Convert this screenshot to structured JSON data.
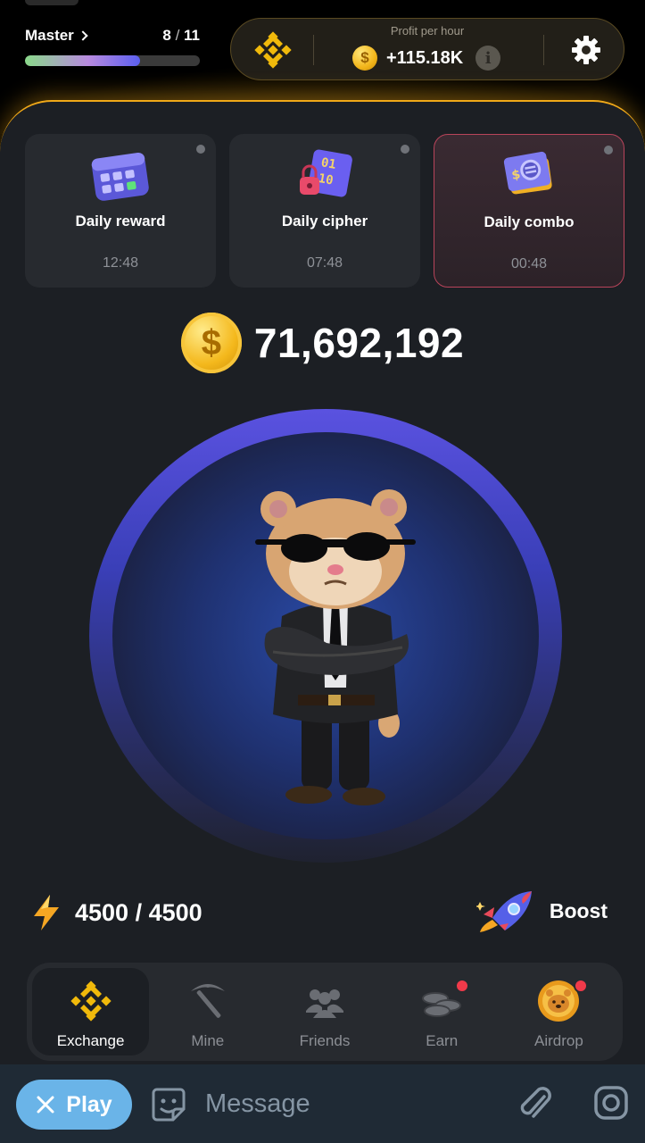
{
  "header": {
    "level_name": "Master",
    "level_current": "8",
    "level_separator": " / ",
    "level_total": "11",
    "level_progress": 0.66,
    "profit_label": "Profit per hour",
    "profit_value": "+115.18K",
    "profit_coin_symbol": "$",
    "info_symbol": "i",
    "exchange_icon": "binance-icon",
    "settings_icon": "gear-icon"
  },
  "daily_cards": [
    {
      "title": "Daily reward",
      "time": "12:48",
      "icon": "calendar-icon"
    },
    {
      "title": "Daily cipher",
      "time": "07:48",
      "icon": "cipher-lock-icon"
    },
    {
      "title": "Daily combo",
      "time": "00:48",
      "icon": "combo-cards-icon"
    }
  ],
  "balance": {
    "coin_symbol": "$",
    "amount": "71,692,192"
  },
  "energy": {
    "value": "4500 / 4500",
    "icon": "lightning-icon"
  },
  "boost": {
    "label": "Boost",
    "icon": "rocket-icon"
  },
  "nav": {
    "items": [
      {
        "label": "Exchange",
        "icon": "binance-icon"
      },
      {
        "label": "Mine",
        "icon": "pickaxe-icon"
      },
      {
        "label": "Friends",
        "icon": "friends-icon"
      },
      {
        "label": "Earn",
        "icon": "coins-icon"
      },
      {
        "label": "Airdrop",
        "icon": "hamster-coin-icon"
      }
    ]
  },
  "chat": {
    "play_label": "Play",
    "message_placeholder": "Message"
  },
  "colors": {
    "accent_gold": "#f0a818",
    "panel_bg": "#1c1f24",
    "card_bg": "#272a2f",
    "play_button": "#6ab4e8",
    "badge_red": "#f03a4a"
  }
}
